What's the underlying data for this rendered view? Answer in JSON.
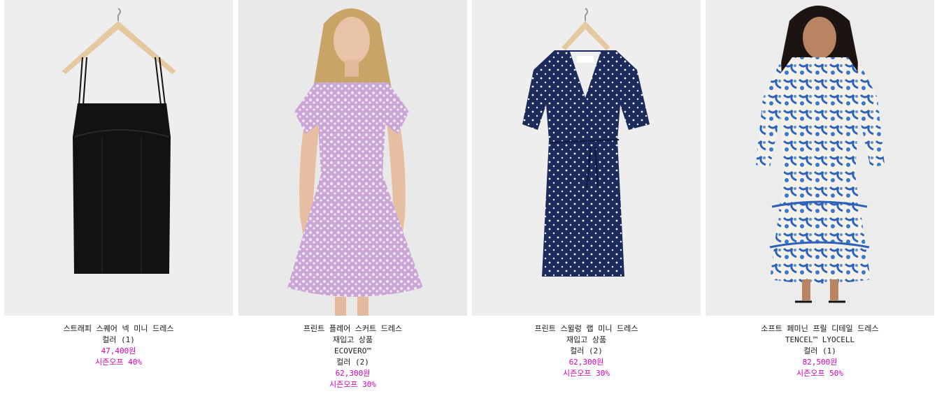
{
  "products": [
    {
      "name": "스트래피 스퀘어 넥 미니 드레스",
      "colors": "컬러 (1)",
      "price": "47,400원",
      "discount": "시즌오프 40%",
      "image_desc": "black-strappy-dress-on-hanger"
    },
    {
      "name": "프린트 플레어 스커트 드레스",
      "restock": "재입고 상품",
      "material": "ECOVERO™",
      "colors": "컬러 (2)",
      "price": "62,300원",
      "discount": "시즌오프 30%",
      "image_desc": "lilac-floral-dress-on-model"
    },
    {
      "name": "프린트 스윌렁 랩 미니 드레스",
      "restock": "재입고 상품",
      "colors": "컬러 (2)",
      "price": "62,300원",
      "discount": "시즌오프 30%",
      "image_desc": "navy-polka-dot-wrap-dress-on-hanger"
    },
    {
      "name": "소프트 페미닌 프릴 디테일 드레스",
      "material": "TENCEL™ LYOCELL",
      "colors": "컬러 (1)",
      "price": "82,500원",
      "discount": "시즌오프 50%",
      "image_desc": "blue-white-floral-maxi-dress-on-model"
    }
  ],
  "colors": {
    "price": "#d100b5",
    "text": "#111111",
    "image_bg": "#ececec"
  }
}
